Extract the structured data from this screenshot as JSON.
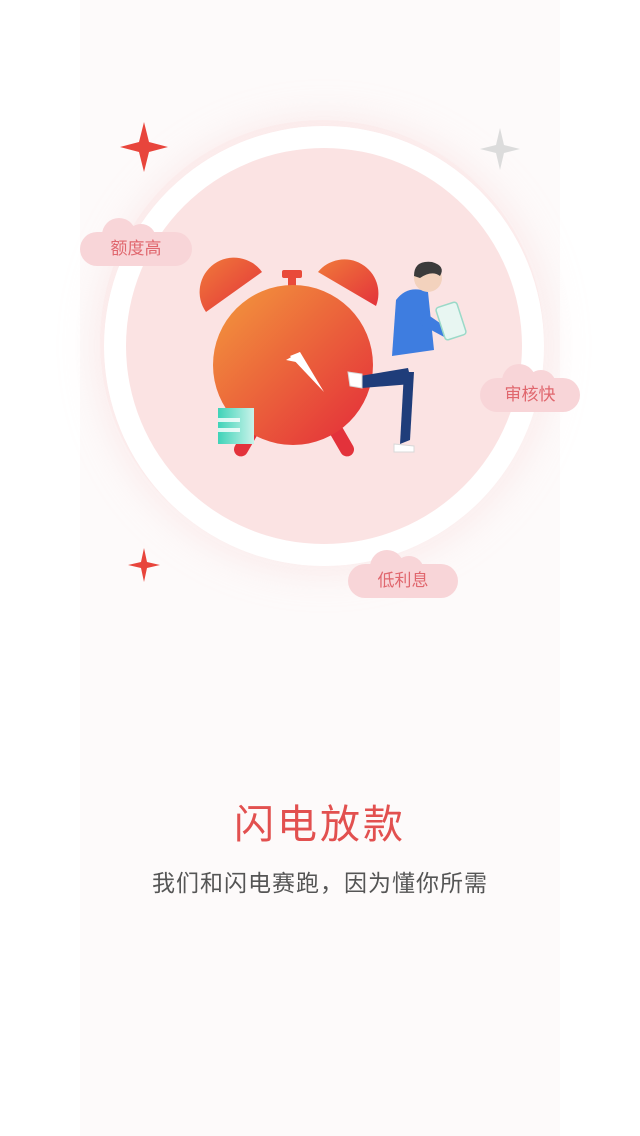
{
  "onboarding": {
    "title": "闪电放款",
    "subtitle": "我们和闪电赛跑，因为懂你所需",
    "tags": [
      "额度高",
      "审核快",
      "低利息"
    ]
  },
  "colors": {
    "accent": "#e2504f",
    "subtitle_text": "#555555",
    "circle_fill": "#fbe3e3",
    "cloud_fill": "#f8d5d8",
    "cloud_text": "#e0676e",
    "sparkle_red": "#e8453c",
    "sparkle_grey": "#dcdcdc"
  },
  "icons": [
    "alarm-clock-icon",
    "person-kicking-icon",
    "money-bill-icon",
    "sparkle-icon"
  ]
}
